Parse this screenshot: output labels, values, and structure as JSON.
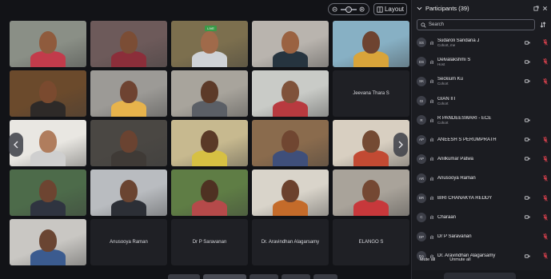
{
  "toolbar": {
    "layout_label": "Layout",
    "zoom_level": 0.2
  },
  "gallery": {
    "tiles": [
      {
        "type": "video",
        "bg": "#8a8f86",
        "skin": "#8f5b3d",
        "shirt": "#c23b4b"
      },
      {
        "type": "video",
        "bg": "#6d5a5a",
        "skin": "#7b4d35",
        "shirt": "#8b2e3a"
      },
      {
        "type": "video",
        "bg": "#7c6f4e",
        "skin": "#a06a4a",
        "shirt": "#cfd2d6",
        "tag": "LIVE"
      },
      {
        "type": "video",
        "bg": "#b9b4ae",
        "skin": "#9a6241",
        "shirt": "#26343f"
      },
      {
        "type": "video",
        "bg": "#87b0c4",
        "skin": "#6e4330",
        "shirt": "#d9a43a"
      },
      {
        "type": "video",
        "bg": "#6b4a2c",
        "skin": "#7a4a2f",
        "shirt": "#2e2a28"
      },
      {
        "type": "video",
        "bg": "#9c9a96",
        "skin": "#6e4331",
        "shirt": "#e7b34c"
      },
      {
        "type": "video",
        "bg": "#a8a49c",
        "skin": "#5c3a28",
        "shirt": "#5b5f66"
      },
      {
        "type": "video",
        "bg": "#c9cbc7",
        "skin": "#7f523a",
        "shirt": "#b83a3f"
      },
      {
        "type": "name",
        "label": "Jeevana Thara S"
      },
      {
        "type": "video",
        "bg": "#e9e7e2",
        "skin": "#b07d5d",
        "shirt": "#cfcfcf"
      },
      {
        "type": "video",
        "bg": "#4a4743",
        "skin": "#6a4331",
        "shirt": "#3f3a36"
      },
      {
        "type": "video",
        "bg": "#c7b98f",
        "skin": "#5a3927",
        "shirt": "#d6c043"
      },
      {
        "type": "video",
        "bg": "#8a6b4d",
        "skin": "#704631",
        "shirt": "#3f4f7a"
      },
      {
        "type": "video",
        "bg": "#d8cfc1",
        "skin": "#744a33",
        "shirt": "#c24a33"
      },
      {
        "type": "video",
        "bg": "#4d6b4a",
        "skin": "#6d4431",
        "shirt": "#2f3440"
      },
      {
        "type": "video",
        "bg": "#b9bcc0",
        "skin": "#6a4431",
        "shirt": "#2c2f36"
      },
      {
        "type": "video",
        "bg": "#5f7d45",
        "skin": "#4e3122",
        "shirt": "#b54a4a"
      },
      {
        "type": "video",
        "bg": "#d9d4ca",
        "skin": "#6b412d",
        "shirt": "#c46b2a"
      },
      {
        "type": "video",
        "bg": "#a9a39a",
        "skin": "#744833",
        "shirt": "#c7383b"
      },
      {
        "type": "video",
        "bg": "#c9c7c3",
        "skin": "#6a4532",
        "shirt": "#3b5b8f"
      },
      {
        "type": "name",
        "label": "Anusooya Raman"
      },
      {
        "type": "name",
        "label": "Dr P Saravanan"
      },
      {
        "type": "name",
        "label": "Dr. Aravindhan Alagarsamy"
      },
      {
        "type": "name",
        "label": "ELANGO S"
      }
    ]
  },
  "panel": {
    "title": "Participants (39)",
    "search_placeholder": "Search",
    "participants": [
      {
        "initials": "SS",
        "name": "Sudaroli Sandana J",
        "role": "Cohort, me",
        "cam": true,
        "mic_muted": true
      },
      {
        "initials": "DS",
        "name": "Delvalakshmi S",
        "role": "Host",
        "cam": true,
        "mic_muted": true
      },
      {
        "initials": "SK",
        "name": "Seckium Ku",
        "role": "Cohort",
        "cam": true,
        "mic_muted": true
      },
      {
        "initials": "GI",
        "name": "GIAN IIT",
        "role": "Cohort",
        "cam": false,
        "mic_muted": false
      },
      {
        "initials": "R",
        "name": "R PANDEESWARI - ECE",
        "role": "Cohort",
        "cam": true,
        "mic_muted": false
      },
      {
        "initials": "AP",
        "name": "ANEESH S PERUMPRATH",
        "role": "",
        "cam": true,
        "mic_muted": true
      },
      {
        "initials": "AP",
        "name": "Anilkumar Patwa",
        "role": "",
        "cam": true,
        "mic_muted": true
      },
      {
        "initials": "AR",
        "name": "Anusooya Raman",
        "role": "",
        "cam": false,
        "mic_muted": true
      },
      {
        "initials": "BR",
        "name": "BIRI CHANAKYA REDDY",
        "role": "",
        "cam": true,
        "mic_muted": true
      },
      {
        "initials": "C",
        "name": "Charaan",
        "role": "",
        "cam": true,
        "mic_muted": true
      },
      {
        "initials": "DP",
        "name": "Dr P Saravanan",
        "role": "",
        "cam": false,
        "mic_muted": true
      },
      {
        "initials": "DA",
        "name": "Dr. Aravindhan Alagarsamy",
        "role": "",
        "cam": true,
        "mic_muted": true
      }
    ],
    "mute_all": "Mute all",
    "unmute_all": "Unmute all"
  },
  "colors": {
    "muted_mic": "#e0424f",
    "panel_bg": "#1b1c21",
    "live_tag": "#3a9b48"
  }
}
